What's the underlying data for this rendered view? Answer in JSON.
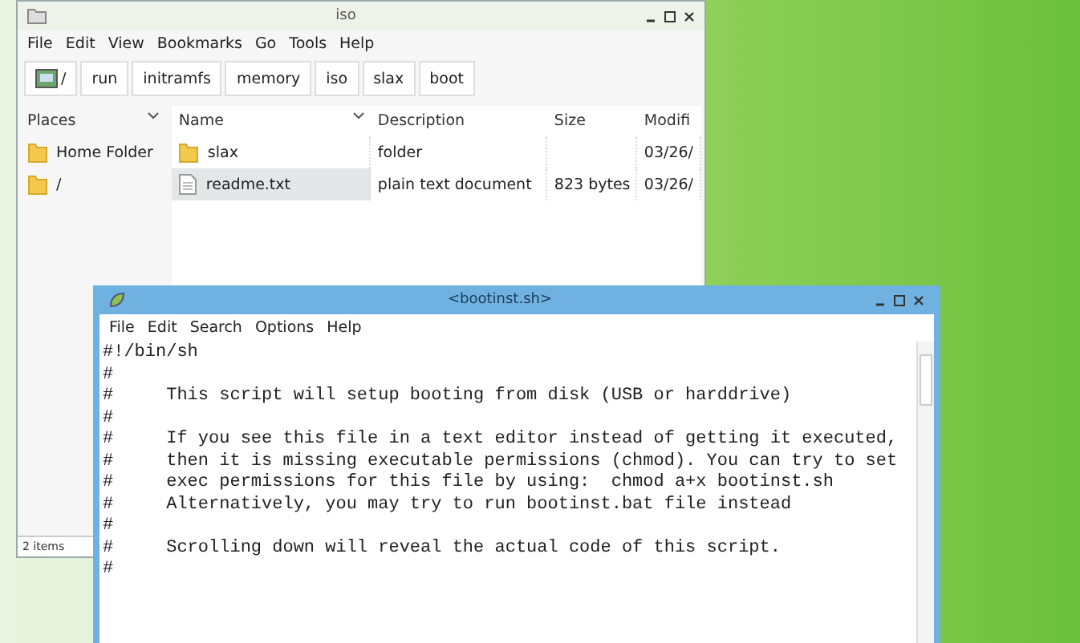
{
  "file_manager": {
    "title": "iso",
    "menu": [
      "File",
      "Edit",
      "View",
      "Bookmarks",
      "Go",
      "Tools",
      "Help"
    ],
    "path": [
      {
        "label": "/",
        "kind": "root"
      },
      {
        "label": "run",
        "kind": "dir"
      },
      {
        "label": "initramfs",
        "kind": "dir"
      },
      {
        "label": "memory",
        "kind": "dir"
      },
      {
        "label": "iso",
        "kind": "dir"
      },
      {
        "label": "slax",
        "kind": "dir"
      },
      {
        "label": "boot",
        "kind": "dir"
      }
    ],
    "places": {
      "title": "Places",
      "items": [
        {
          "label": "Home Folder"
        },
        {
          "label": "/"
        }
      ]
    },
    "columns": [
      "Name",
      "Description",
      "Size",
      "Modifi"
    ],
    "rows": [
      {
        "name": "slax",
        "kind": "folder",
        "description": "folder",
        "size": "",
        "modified": "03/26/",
        "selected": false
      },
      {
        "name": "readme.txt",
        "kind": "file",
        "description": "plain text document",
        "size": "823 bytes",
        "modified": "03/26/",
        "selected": true
      }
    ],
    "status": "2 items"
  },
  "editor": {
    "title": "<bootinst.sh>",
    "menu": [
      "File",
      "Edit",
      "Search",
      "Options",
      "Help"
    ],
    "lines": [
      "#!/bin/sh",
      "#",
      "#     This script will setup booting from disk (USB or harddrive)",
      "#",
      "#     If you see this file in a text editor instead of getting it executed,",
      "#     then it is missing executable permissions (chmod). You can try to set",
      "#     exec permissions for this file by using:  chmod a+x bootinst.sh",
      "#     Alternatively, you may try to run bootinst.bat file instead",
      "#",
      "#     Scrolling down will reveal the actual code of this script.",
      "#"
    ]
  }
}
